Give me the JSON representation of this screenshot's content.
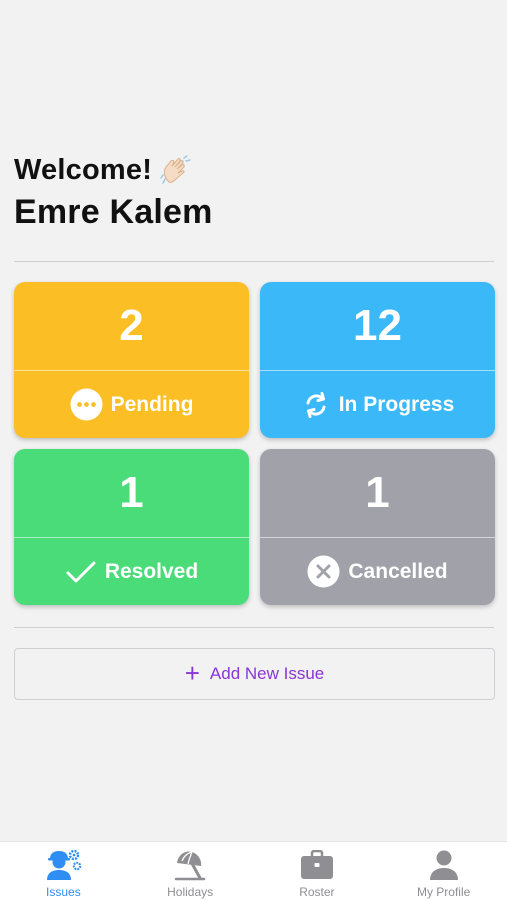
{
  "greeting": {
    "welcome": "Welcome!",
    "name": "Emre Kalem"
  },
  "cards": [
    {
      "key": "pending",
      "count": "2",
      "label": "Pending",
      "color": "#fbbf25"
    },
    {
      "key": "in_progress",
      "count": "12",
      "label": "In Progress",
      "color": "#3bb8f7"
    },
    {
      "key": "resolved",
      "count": "1",
      "label": "Resolved",
      "color": "#49dc79"
    },
    {
      "key": "cancelled",
      "count": "1",
      "label": "Cancelled",
      "color": "#a0a1a9"
    }
  ],
  "add_issue": {
    "icon": "+",
    "label": "Add New Issue",
    "color": "#8a35d6"
  },
  "tabs": [
    {
      "label": "Issues",
      "icon": "worker-gear-icon",
      "active": true
    },
    {
      "label": "Holidays",
      "icon": "beach-umbrella-icon"
    },
    {
      "label": "Roster",
      "icon": "briefcase-icon"
    },
    {
      "label": "My Profile",
      "icon": "person-icon"
    }
  ],
  "colors": {
    "accent": "#2f8ef4",
    "background": "#f2f2f3"
  }
}
